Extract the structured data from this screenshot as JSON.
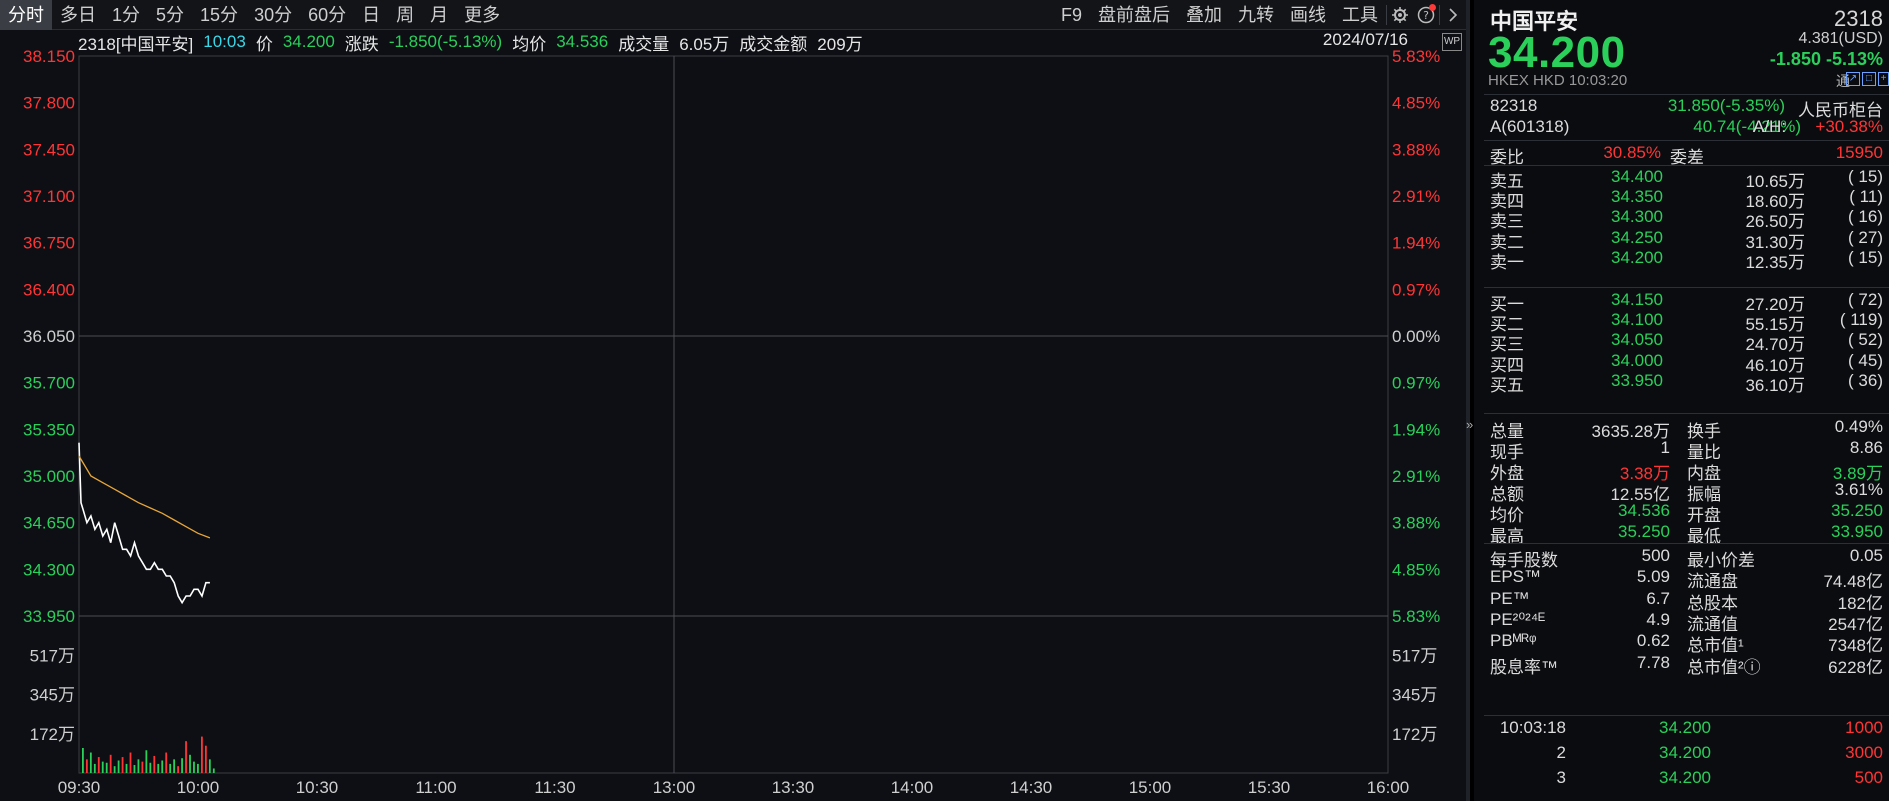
{
  "toolbar": {
    "periods": [
      "分时",
      "多日",
      "1分",
      "5分",
      "15分",
      "30分",
      "60分",
      "日",
      "周",
      "月",
      "更多"
    ],
    "right_items": [
      "F9",
      "盘前盘后",
      "叠加",
      "九转",
      "画线",
      "工具"
    ]
  },
  "infobar": {
    "code_name": "2318[中国平安]",
    "time": "10:03",
    "price_label": "价",
    "price": "34.200",
    "change_label": "涨跌",
    "change": "-1.850(-5.13%)",
    "avg_label": "均价",
    "avg": "34.536",
    "volume_label": "成交量",
    "volume": "6.05万",
    "amount_label": "成交金额",
    "amount": "209万",
    "date": "2024/07/16",
    "wp_icon": "WP"
  },
  "chart_data": {
    "type": "line",
    "title": "",
    "x_ticks": [
      "09:30",
      "10:00",
      "10:30",
      "11:00",
      "11:30",
      "13:00",
      "13:30",
      "14:00",
      "14:30",
      "15:00",
      "15:30",
      "16:00"
    ],
    "price_ticks": [
      "38.150",
      "37.800",
      "37.450",
      "37.100",
      "36.750",
      "36.400",
      "36.050",
      "35.700",
      "35.350",
      "35.000",
      "34.650",
      "34.300",
      "33.950"
    ],
    "pct_ticks": [
      "5.83%",
      "4.85%",
      "3.88%",
      "2.91%",
      "1.94%",
      "0.97%",
      "0.00%",
      "0.97%",
      "1.94%",
      "2.91%",
      "3.88%",
      "4.85%",
      "5.83%"
    ],
    "volume_ticks": [
      "517万",
      "345万",
      "172万"
    ],
    "ylim": [
      33.95,
      38.15
    ],
    "prev_close": 36.05,
    "series": [
      {
        "kind": "price",
        "x_minutes": [
          0,
          0.5,
          1,
          2,
          3,
          4,
          5,
          6,
          7,
          8,
          9,
          10,
          11,
          12,
          13,
          14,
          15,
          16,
          17,
          18,
          19,
          20,
          21,
          22,
          23,
          24,
          25,
          26,
          27,
          28,
          29,
          30,
          31,
          32,
          33
        ],
        "values": [
          35.25,
          34.8,
          34.75,
          34.65,
          34.7,
          34.6,
          34.65,
          34.55,
          34.6,
          34.5,
          34.65,
          34.55,
          34.45,
          34.45,
          34.4,
          34.5,
          34.4,
          34.35,
          34.3,
          34.3,
          34.35,
          34.3,
          34.3,
          34.25,
          34.25,
          34.2,
          34.1,
          34.05,
          34.1,
          34.1,
          34.15,
          34.15,
          34.1,
          34.2,
          34.2
        ]
      },
      {
        "kind": "avg",
        "x_minutes": [
          0,
          3,
          6,
          9,
          12,
          15,
          18,
          21,
          24,
          27,
          30,
          33
        ],
        "values": [
          35.15,
          35.0,
          34.95,
          34.9,
          34.85,
          34.8,
          34.76,
          34.72,
          34.67,
          34.62,
          34.57,
          34.536
        ]
      }
    ],
    "volume": {
      "x_minutes": [
        0,
        1,
        2,
        3,
        4,
        5,
        6,
        7,
        8,
        9,
        10,
        11,
        12,
        13,
        14,
        15,
        16,
        17,
        18,
        19,
        20,
        21,
        22,
        23,
        24,
        25,
        26,
        27,
        28,
        29,
        30,
        31,
        32,
        33
      ],
      "values": [
        110,
        60,
        90,
        40,
        70,
        50,
        45,
        80,
        30,
        55,
        70,
        40,
        90,
        35,
        60,
        50,
        100,
        45,
        75,
        40,
        55,
        90,
        40,
        60,
        30,
        65,
        140,
        80,
        50,
        40,
        160,
        120,
        60,
        20
      ],
      "up": [
        false,
        true,
        false,
        false,
        true,
        false,
        false,
        true,
        false,
        false,
        true,
        false,
        true,
        false,
        false,
        true,
        false,
        false,
        true,
        false,
        false,
        true,
        false,
        false,
        true,
        false,
        true,
        false,
        false,
        false,
        true,
        true,
        false,
        false
      ],
      "ylim": [
        0,
        690
      ]
    }
  },
  "quote": {
    "name": "中国平安",
    "code": "2318",
    "price": "34.200",
    "usd": "4.381(USD)",
    "change": "-1.850 -5.13%",
    "sub": "HKEX HKD 10:03:20",
    "tong": "通",
    "mini_icons": [
      "↗",
      "□",
      "+"
    ],
    "linked": [
      {
        "c1": "82318",
        "c2": "31.850(-5.35%)",
        "c4": "人民币柜台"
      },
      {
        "c1": "A(601318)",
        "c2": "40.74(-4.21%)",
        "c3": "A/H:",
        "c4": "+30.38%"
      }
    ],
    "ratio_label": "委比",
    "ratio": "30.85%",
    "diff_label": "委差",
    "diff": "15950",
    "asks": [
      {
        "label": "卖五",
        "price": "34.400",
        "vol": "10.65万",
        "cnt": "( 15)"
      },
      {
        "label": "卖四",
        "price": "34.350",
        "vol": "18.60万",
        "cnt": "( 11)"
      },
      {
        "label": "卖三",
        "price": "34.300",
        "vol": "26.50万",
        "cnt": "( 16)"
      },
      {
        "label": "卖二",
        "price": "34.250",
        "vol": "31.30万",
        "cnt": "( 27)"
      },
      {
        "label": "卖一",
        "price": "34.200",
        "vol": "12.35万",
        "cnt": "( 15)"
      }
    ],
    "bids": [
      {
        "label": "买一",
        "price": "34.150",
        "vol": "27.20万",
        "cnt": "( 72)"
      },
      {
        "label": "买二",
        "price": "34.100",
        "vol": "55.15万",
        "cnt": "( 119)"
      },
      {
        "label": "买三",
        "price": "34.050",
        "vol": "24.70万",
        "cnt": "( 52)"
      },
      {
        "label": "买四",
        "price": "34.000",
        "vol": "46.10万",
        "cnt": "( 45)"
      },
      {
        "label": "买五",
        "price": "33.950",
        "vol": "36.10万",
        "cnt": "( 36)"
      }
    ],
    "stats": [
      {
        "l1": "总量",
        "v1": "3635.28万",
        "c1": "white",
        "l2": "换手",
        "v2": "0.49%",
        "c2": "white"
      },
      {
        "l1": "现手",
        "v1": "1",
        "c1": "white",
        "l2": "量比",
        "v2": "8.86",
        "c2": "white"
      },
      {
        "l1": "外盘",
        "v1": "3.38万",
        "c1": "red",
        "l2": "内盘",
        "v2": "3.89万",
        "c2": "green"
      },
      {
        "l1": "总额",
        "v1": "12.55亿",
        "c1": "white",
        "l2": "振幅",
        "v2": "3.61%",
        "c2": "white"
      },
      {
        "l1": "均价",
        "v1": "34.536",
        "c1": "green",
        "l2": "开盘",
        "v2": "35.250",
        "c2": "green"
      },
      {
        "l1": "最高",
        "v1": "35.250",
        "c1": "green",
        "l2": "最低",
        "v2": "33.950",
        "c2": "green"
      }
    ],
    "fundamentals": [
      {
        "l1": "每手股数",
        "v1": "500",
        "l2": "最小价差",
        "v2": "0.05"
      },
      {
        "l1": "EPS™",
        "v1": "5.09",
        "l2": "流通盘",
        "v2": "74.48亿"
      },
      {
        "l1": "PE™",
        "v1": "6.7",
        "l2": "总股本",
        "v2": "182亿"
      },
      {
        "l1": "PE²⁰²⁴ᴱ",
        "v1": "4.9",
        "l2": "流通值",
        "v2": "2547亿"
      },
      {
        "l1": "PBᴹᴿᵠ",
        "v1": "0.62",
        "l2": "总市值¹",
        "v2": "7348亿"
      },
      {
        "l1": "股息率™",
        "v1": "7.78",
        "l2": "总市值²ⓘ",
        "v2": "6228亿"
      }
    ],
    "ticks": [
      {
        "time": "10:03:18",
        "price": "34.200",
        "vol": "1000"
      },
      {
        "time": "2",
        "price": "34.200",
        "vol": "3000"
      },
      {
        "time": "3",
        "price": "34.200",
        "vol": "500"
      }
    ]
  },
  "colors": {
    "up": "#ff3535",
    "down": "#2ad05a",
    "avg_line": "#e8a63a",
    "price_line": "#ffffff"
  }
}
